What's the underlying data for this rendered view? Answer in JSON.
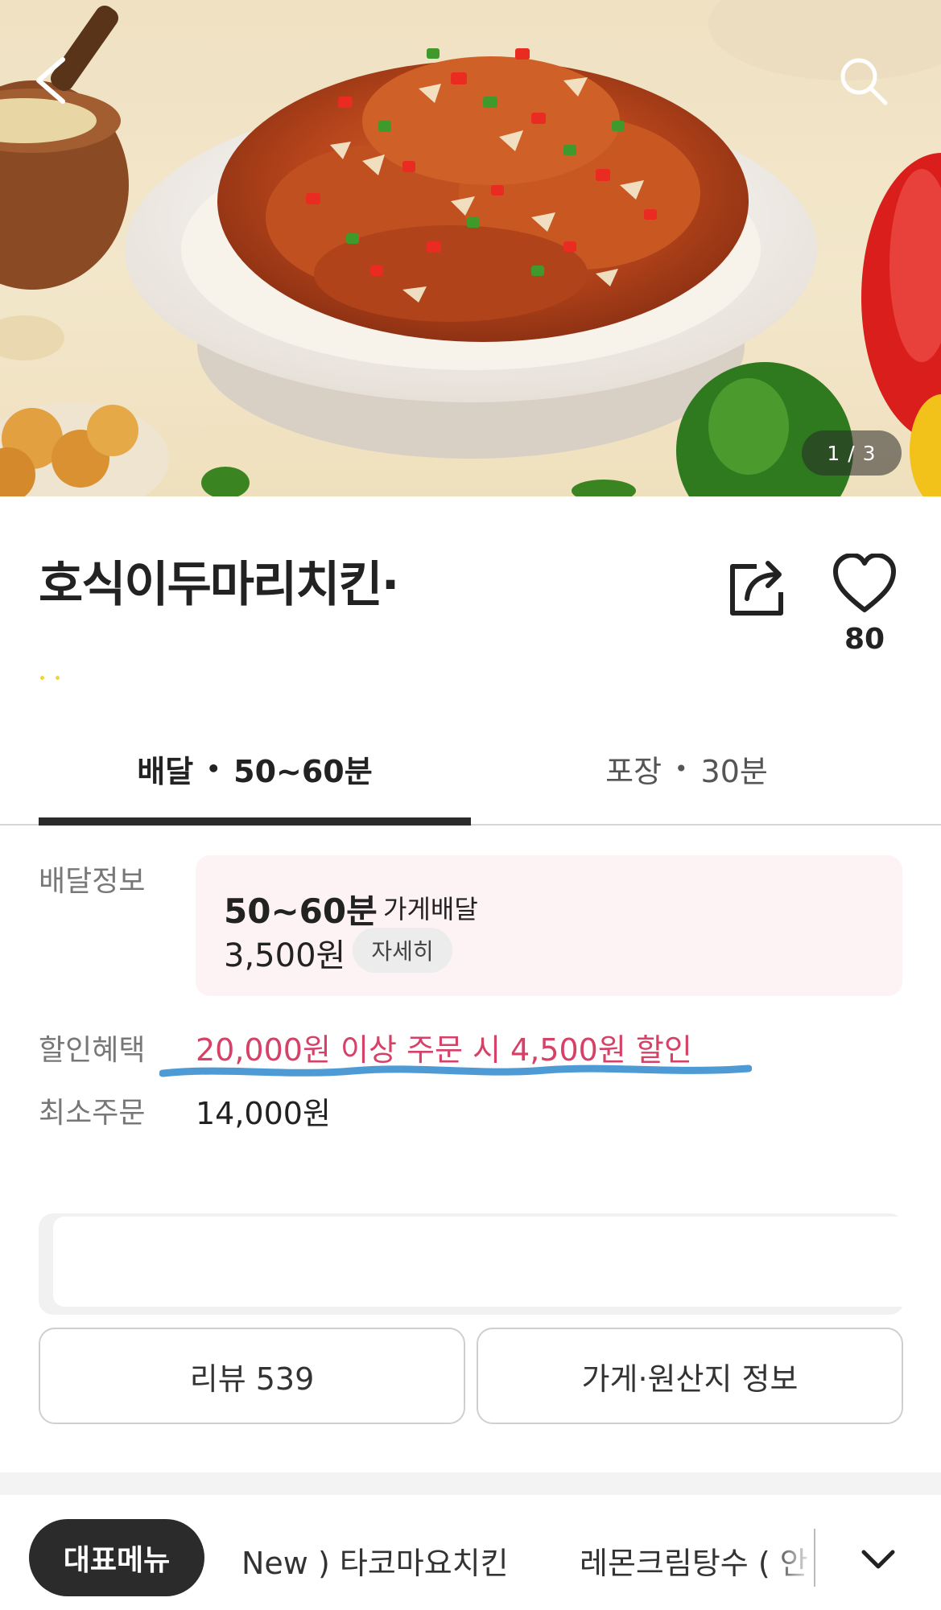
{
  "hero": {
    "image_counter": "1 / 3",
    "back_icon": "chevron-left-icon",
    "search_icon": "search-icon"
  },
  "store": {
    "name": "호식이두마리치킨·",
    "like_count": "80",
    "share_icon": "share-icon",
    "like_icon": "heart-icon"
  },
  "tabs": {
    "delivery": {
      "label": "배달",
      "separator": "•",
      "time": "50~60분"
    },
    "pickup": {
      "label": "포장",
      "separator": "•",
      "time": "30분"
    }
  },
  "delivery_info": {
    "label": "배달정보",
    "time": "50~60분",
    "type": "가게배달",
    "fee": "3,500원",
    "detail_button": "자세히"
  },
  "discount": {
    "label": "할인혜택",
    "value": "20,000원 이상 주문 시 4,500원 할인"
  },
  "min_order": {
    "label": "최소주문",
    "value": "14,000원"
  },
  "buttons": {
    "review": "리뷰 539",
    "store_info": "가게·원산지 정보"
  },
  "categories": {
    "active": "대표메뉴",
    "items": [
      "New ) 타코마요치킨",
      "레몬크림탕수 ( 안"
    ],
    "expand_icon": "chevron-down-icon"
  },
  "colors": {
    "discount_text": "#d64167",
    "delivery_card_bg": "#fdf2f4",
    "active_pill": "#2b2b2b",
    "annotation_underline": "#3a8fd0"
  }
}
